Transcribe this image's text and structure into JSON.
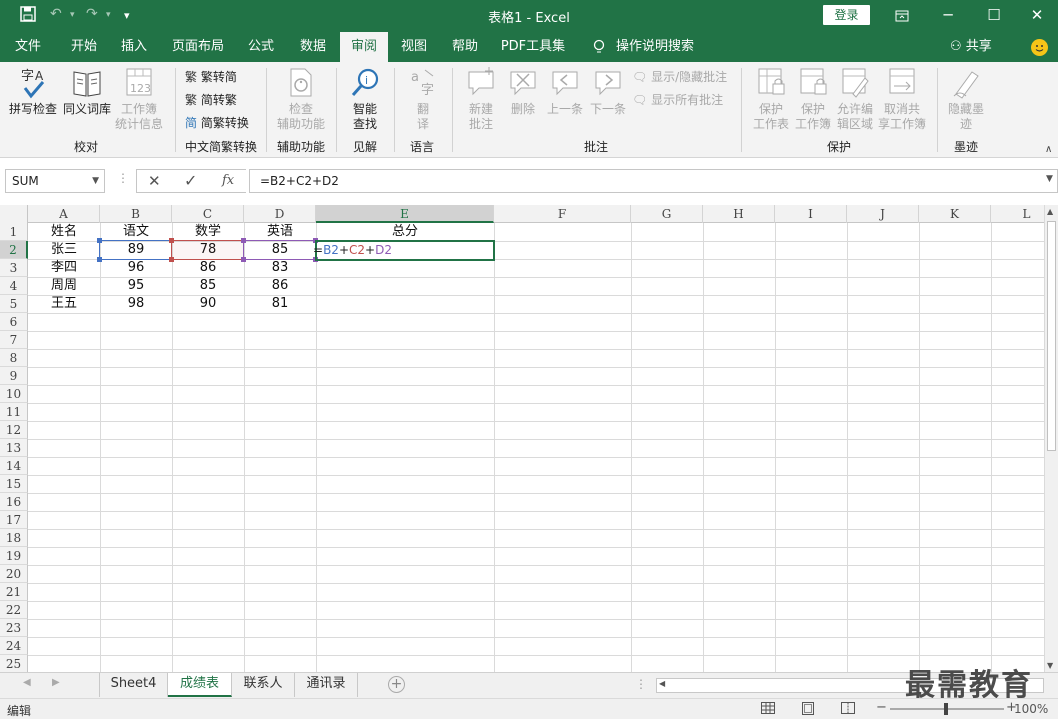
{
  "titlebar": {
    "title": "表格1  -  Excel",
    "login": "登录",
    "min": "─",
    "max": "☐",
    "close": "✕",
    "save_icon": "save-icon",
    "undo_icon": "undo-icon",
    "redo_icon": "redo-icon"
  },
  "tabs": [
    "文件",
    "开始",
    "插入",
    "页面布局",
    "公式",
    "数据",
    "审阅",
    "视图",
    "帮助",
    "PDF工具集",
    "操作说明搜索"
  ],
  "active_tab": "审阅",
  "share": "共享",
  "ribbon": {
    "spell_check": "拼写检查",
    "thesaurus": "同义词库",
    "workbook_stats_1": "工作簿",
    "workbook_stats_2": "统计信息",
    "group_proofing": "校对",
    "to_traditional": "繁转简",
    "to_simplified": "简转繁",
    "convert": "简繁转换",
    "group_chinese": "中文简繁转换",
    "check_access_1": "检查",
    "check_access_2": "辅助功能",
    "group_access": "辅助功能",
    "smart_lookup_1": "智能",
    "smart_lookup_2": "查找",
    "group_insights": "见解",
    "translate_1": "翻",
    "translate_2": "译",
    "group_language": "语言",
    "new_comment_1": "新建",
    "new_comment_2": "批注",
    "delete": "删除",
    "previous": "上一条",
    "next": "下一条",
    "show_hide": "显示/隐藏批注",
    "show_all": "显示所有批注",
    "group_comments": "批注",
    "protect_sheet_1": "保护",
    "protect_sheet_2": "工作表",
    "protect_wb_1": "保护",
    "protect_wb_2": "工作簿",
    "allow_edit_1": "允许编",
    "allow_edit_2": "辑区域",
    "unshare_1": "取消共",
    "unshare_2": "享工作簿",
    "group_protect": "保护",
    "hide_ink_1": "隐藏墨",
    "hide_ink_2": "迹",
    "group_ink": "墨迹"
  },
  "formula_bar": {
    "name_box": "SUM",
    "cancel": "✕",
    "enter": "✓",
    "fx": "fx",
    "formula": "=B2+C2+D2"
  },
  "columns": [
    "A",
    "B",
    "C",
    "D",
    "E",
    "F",
    "G",
    "H",
    "I",
    "J",
    "K",
    "L"
  ],
  "rows": [
    "1",
    "2",
    "3",
    "4",
    "5",
    "6",
    "7",
    "8",
    "9",
    "10",
    "11",
    "12",
    "13",
    "14",
    "15",
    "16",
    "17",
    "18",
    "19",
    "20",
    "21",
    "22",
    "23",
    "24",
    "25"
  ],
  "table": {
    "headers": [
      "姓名",
      "语文",
      "数学",
      "英语",
      "总分"
    ],
    "data": [
      [
        "张三",
        "89",
        "78",
        "85"
      ],
      [
        "李四",
        "96",
        "86",
        "83"
      ],
      [
        "周周",
        "95",
        "85",
        "86"
      ],
      [
        "王五",
        "98",
        "90",
        "81"
      ]
    ]
  },
  "edit_formula": {
    "eq": "=",
    "b2": "B2",
    "plus1": "+",
    "c2": "C2",
    "plus2": "+",
    "d2": "D2"
  },
  "colors": {
    "excel_green": "#217346",
    "ref_b2": "#4472c4",
    "ref_c2": "#c0504d",
    "ref_d2": "#8e5ab5"
  },
  "sheets": [
    "Sheet4",
    "成绩表",
    "联系人",
    "通讯录"
  ],
  "active_sheet": "成绩表",
  "status": "编辑",
  "zoom": "100%",
  "watermark": "最需教育"
}
